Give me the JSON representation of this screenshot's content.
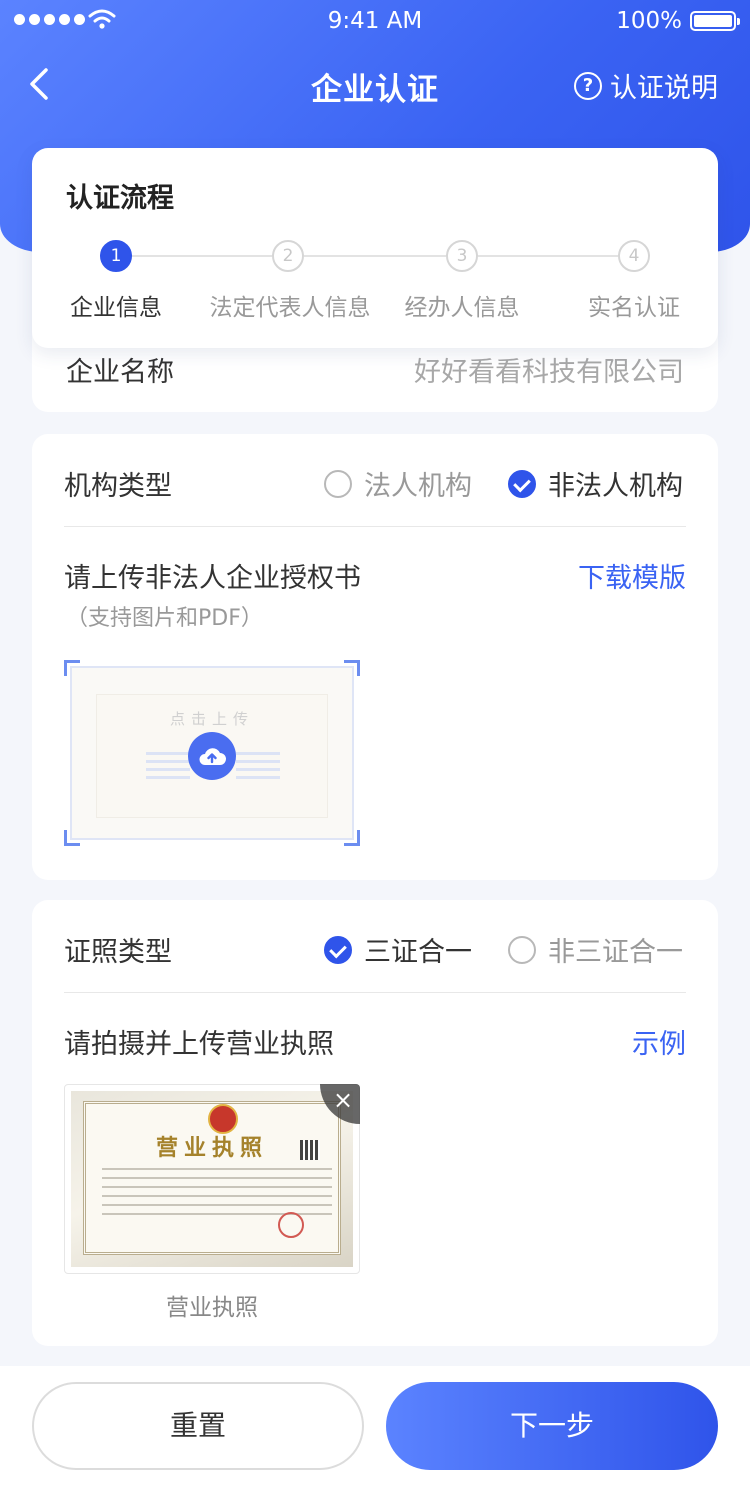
{
  "status_bar": {
    "time": "9:41 AM",
    "battery": "100%"
  },
  "nav": {
    "title": "企业认证",
    "help_label": "认证说明"
  },
  "process": {
    "title": "认证流程",
    "steps": [
      {
        "number": "1",
        "label": "企业信息"
      },
      {
        "number": "2",
        "label": "法定代表人信息"
      },
      {
        "number": "3",
        "label": "经办人信息"
      },
      {
        "number": "4",
        "label": "实名认证"
      }
    ],
    "active_step": 1
  },
  "company": {
    "label": "企业名称",
    "value": "好好看看科技有限公司"
  },
  "org_type": {
    "label": "机构类型",
    "options": [
      "法人机构",
      "非法人机构"
    ],
    "selected": "非法人机构"
  },
  "authorization": {
    "title": "请上传非法人企业授权书",
    "hint": "（支持图片和PDF）",
    "download_label": "下载模版",
    "upload_hint": "点击上传"
  },
  "license_type": {
    "label": "证照类型",
    "options": [
      "三证合一",
      "非三证合一"
    ],
    "selected": "三证合一"
  },
  "license_upload": {
    "title": "请拍摄并上传营业执照",
    "example_label": "示例",
    "image_title": "营业执照",
    "caption": "营业执照"
  },
  "actions": {
    "reset_label": "重置",
    "next_label": "下一步"
  },
  "colors": {
    "primary": "#2f54ea",
    "gradient_start": "#5b83ff"
  }
}
